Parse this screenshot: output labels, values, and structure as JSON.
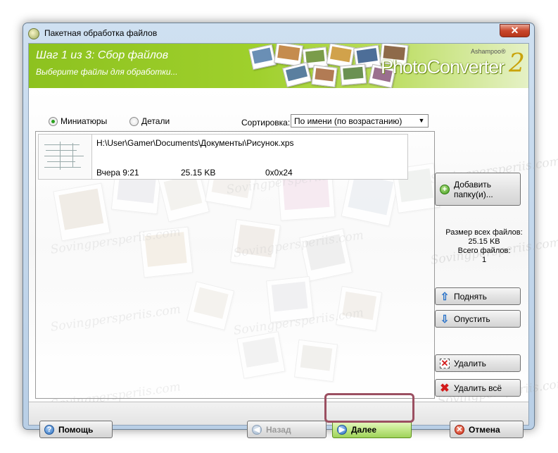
{
  "window": {
    "title": "Пакетная обработка файлов",
    "close_glyph": "✕"
  },
  "banner": {
    "step_title": "Шаг 1 из 3: Сбор файлов",
    "step_subtitle": "Выберите файлы для обработки...",
    "logo_brand": "Ashampoo®",
    "logo_name": "PhotoConverter",
    "logo_version": "2"
  },
  "view": {
    "thumbnails_label": "Миниатюры",
    "details_label": "Детали",
    "selected": "thumbnails"
  },
  "sort": {
    "label": "Сортировка:",
    "value": "По имени (по возрастанию)",
    "arrow": "▼"
  },
  "files": [
    {
      "path": "H:\\User\\Gamer\\Documents\\Документы\\Рисунок.xps",
      "date": "Вчера 9:21",
      "size": "25.15 KB",
      "dimensions": "0x0x24"
    }
  ],
  "side_buttons": {
    "add_folder": "Добавить папку(и)...",
    "move_up": "Поднять",
    "move_down": "Опустить",
    "remove": "Удалить",
    "remove_all": "Удалить всё"
  },
  "stats": {
    "total_size_label": "Размер всех файлов:",
    "total_size_value": "25.15 KB",
    "total_count_label": "Всего файлов:",
    "total_count_value": "1"
  },
  "bottom_buttons": {
    "help": "Помощь",
    "back": "Назад",
    "next": "Далее",
    "cancel": "Отмена"
  },
  "icons": {
    "help": "?",
    "back": "◀",
    "next": "▶",
    "cancel": "✕",
    "add": "+",
    "up": "⇧",
    "down": "⇩",
    "remove": "✕",
    "remove_all": "✖"
  },
  "watermark_text": "Sovingpersperiis.com",
  "colors": {
    "banner_green": "#8dc21f",
    "highlight_border": "#9b4f61",
    "next_button": "#c3e88a",
    "close_red": "#c9472c"
  }
}
